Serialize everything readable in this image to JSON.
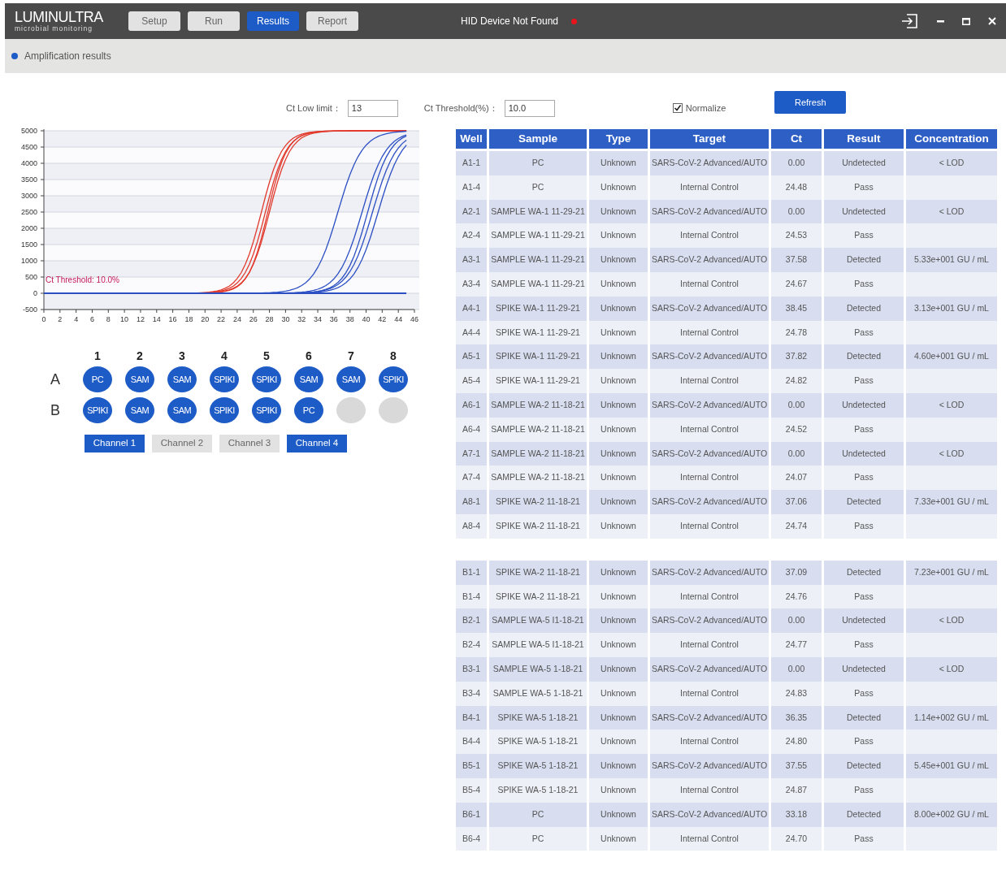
{
  "window": {
    "logo": "LUMINULTRA",
    "logo_tagline": "microbial monitoring",
    "tabs": [
      {
        "label": "Setup",
        "selected": false
      },
      {
        "label": "Run",
        "selected": false
      },
      {
        "label": "Results",
        "selected": true
      },
      {
        "label": "Report",
        "selected": false
      }
    ],
    "status": "HID Device Not Found"
  },
  "section": {
    "title": "Amplification results"
  },
  "controls": {
    "ct_low_limit": {
      "label": "Ct Low limit：",
      "value": "13"
    },
    "ct_threshold": {
      "label": "Ct Threshold(%)：",
      "value": "10.0"
    },
    "normalize": {
      "label": "Normalize",
      "checked": true
    },
    "refresh": "Refresh"
  },
  "chart": {
    "y_ticks": [
      "5000",
      "4500",
      "4000",
      "3500",
      "3000",
      "2500",
      "2000",
      "1500",
      "1000",
      "500",
      "0",
      "-500"
    ],
    "x_ticks": [
      "0",
      "2",
      "4",
      "6",
      "8",
      "10",
      "12",
      "14",
      "16",
      "18",
      "20",
      "22",
      "24",
      "26",
      "28",
      "30",
      "32",
      "34",
      "36",
      "38",
      "40",
      "42",
      "44",
      "46"
    ],
    "threshold_label": "Ct Threshold: 10.0%"
  },
  "plate": {
    "columns": [
      "1",
      "2",
      "3",
      "4",
      "5",
      "6",
      "7",
      "8"
    ],
    "rows": [
      {
        "label": "A",
        "wells": [
          {
            "label": "PC",
            "filled": true
          },
          {
            "label": "SAM",
            "filled": true
          },
          {
            "label": "SAM",
            "filled": true
          },
          {
            "label": "SPIKI",
            "filled": true
          },
          {
            "label": "SPIKI",
            "filled": true
          },
          {
            "label": "SAM",
            "filled": true
          },
          {
            "label": "SAM",
            "filled": true
          },
          {
            "label": "SPIKI",
            "filled": true
          }
        ]
      },
      {
        "label": "B",
        "wells": [
          {
            "label": "SPIKI",
            "filled": true
          },
          {
            "label": "SAM",
            "filled": true
          },
          {
            "label": "SAM",
            "filled": true
          },
          {
            "label": "SPIKI",
            "filled": true
          },
          {
            "label": "SPIKI",
            "filled": true
          },
          {
            "label": "PC",
            "filled": true
          },
          {
            "filled": false
          },
          {
            "filled": false
          }
        ]
      }
    ]
  },
  "channels": [
    {
      "label": "Channel 1",
      "selected": true
    },
    {
      "label": "Channel 2",
      "selected": false
    },
    {
      "label": "Channel 3",
      "selected": false
    },
    {
      "label": "Channel 4",
      "selected": true
    }
  ],
  "results_table": {
    "columns": [
      "Well",
      "Sample",
      "Type",
      "Target",
      "Ct",
      "Result",
      "Concentration"
    ],
    "groups": [
      {
        "rows": [
          [
            "A1-1",
            "PC",
            "Unknown",
            "SARS-CoV-2 Advanced/AUTO",
            "0.00",
            "Undetected",
            "< LOD"
          ],
          [
            "A1-4",
            "PC",
            "Unknown",
            "Internal Control",
            "24.48",
            "Pass",
            ""
          ],
          [
            "A2-1",
            "SAMPLE WA-1 11-29-21",
            "Unknown",
            "SARS-CoV-2 Advanced/AUTO",
            "0.00",
            "Undetected",
            "< LOD"
          ],
          [
            "A2-4",
            "SAMPLE WA-1 11-29-21",
            "Unknown",
            "Internal Control",
            "24.53",
            "Pass",
            ""
          ],
          [
            "A3-1",
            "SAMPLE WA-1 11-29-21",
            "Unknown",
            "SARS-CoV-2 Advanced/AUTO",
            "37.58",
            "Detected",
            "5.33e+001 GU / mL"
          ],
          [
            "A3-4",
            "SAMPLE WA-1 11-29-21",
            "Unknown",
            "Internal Control",
            "24.67",
            "Pass",
            ""
          ],
          [
            "A4-1",
            "SPIKE WA-1 11-29-21",
            "Unknown",
            "SARS-CoV-2 Advanced/AUTO",
            "38.45",
            "Detected",
            "3.13e+001 GU / mL"
          ],
          [
            "A4-4",
            "SPIKE WA-1 11-29-21",
            "Unknown",
            "Internal Control",
            "24.78",
            "Pass",
            ""
          ],
          [
            "A5-1",
            "SPIKE WA-1 11-29-21",
            "Unknown",
            "SARS-CoV-2 Advanced/AUTO",
            "37.82",
            "Detected",
            "4.60e+001 GU / mL"
          ],
          [
            "A5-4",
            "SPIKE WA-1 11-29-21",
            "Unknown",
            "Internal Control",
            "24.82",
            "Pass",
            ""
          ],
          [
            "A6-1",
            "SAMPLE WA-2 11-18-21",
            "Unknown",
            "SARS-CoV-2 Advanced/AUTO",
            "0.00",
            "Undetected",
            "< LOD"
          ],
          [
            "A6-4",
            "SAMPLE WA-2 11-18-21",
            "Unknown",
            "Internal Control",
            "24.52",
            "Pass",
            ""
          ],
          [
            "A7-1",
            "SAMPLE WA-2 11-18-21",
            "Unknown",
            "SARS-CoV-2 Advanced/AUTO",
            "0.00",
            "Undetected",
            "< LOD"
          ],
          [
            "A7-4",
            "SAMPLE WA-2 11-18-21",
            "Unknown",
            "Internal Control",
            "24.07",
            "Pass",
            ""
          ],
          [
            "A8-1",
            "SPIKE WA-2 11-18-21",
            "Unknown",
            "SARS-CoV-2 Advanced/AUTO",
            "37.06",
            "Detected",
            "7.33e+001 GU / mL"
          ],
          [
            "A8-4",
            "SPIKE WA-2 11-18-21",
            "Unknown",
            "Internal Control",
            "24.74",
            "Pass",
            ""
          ]
        ]
      },
      {
        "rows": [
          [
            "B1-1",
            "SPIKE WA-2 11-18-21",
            "Unknown",
            "SARS-CoV-2 Advanced/AUTO",
            "37.09",
            "Detected",
            "7.23e+001 GU / mL"
          ],
          [
            "B1-4",
            "SPIKE WA-2 11-18-21",
            "Unknown",
            "Internal Control",
            "24.76",
            "Pass",
            ""
          ],
          [
            "B2-1",
            "SAMPLE WA-5 I1-18-21",
            "Unknown",
            "SARS-CoV-2 Advanced/AUTO",
            "0.00",
            "Undetected",
            "< LOD"
          ],
          [
            "B2-4",
            "SAMPLE WA-5 I1-18-21",
            "Unknown",
            "Internal Control",
            "24.77",
            "Pass",
            ""
          ],
          [
            "B3-1",
            "SAMPLE WA-5 1-18-21",
            "Unknown",
            "SARS-CoV-2 Advanced/AUTO",
            "0.00",
            "Undetected",
            "< LOD"
          ],
          [
            "B3-4",
            "SAMPLE WA-5 1-18-21",
            "Unknown",
            "Internal Control",
            "24.83",
            "Pass",
            ""
          ],
          [
            "B4-1",
            "SPIKE WA-5 1-18-21",
            "Unknown",
            "SARS-CoV-2 Advanced/AUTO",
            "36.35",
            "Detected",
            "1.14e+002 GU / mL"
          ],
          [
            "B4-4",
            "SPIKE WA-5 1-18-21",
            "Unknown",
            "Internal Control",
            "24.80",
            "Pass",
            ""
          ],
          [
            "B5-1",
            "SPIKE WA-5 1-18-21",
            "Unknown",
            "SARS-CoV-2 Advanced/AUTO",
            "37.55",
            "Detected",
            "5.45e+001 GU / mL"
          ],
          [
            "B5-4",
            "SPIKE WA-5 1-18-21",
            "Unknown",
            "Internal Control",
            "24.87",
            "Pass",
            ""
          ],
          [
            "B6-1",
            "PC",
            "Unknown",
            "SARS-CoV-2 Advanced/AUTO",
            "33.18",
            "Detected",
            "8.00e+002 GU / mL"
          ],
          [
            "B6-4",
            "PC",
            "Unknown",
            "Internal Control",
            "24.70",
            "Pass",
            ""
          ]
        ]
      }
    ]
  }
}
